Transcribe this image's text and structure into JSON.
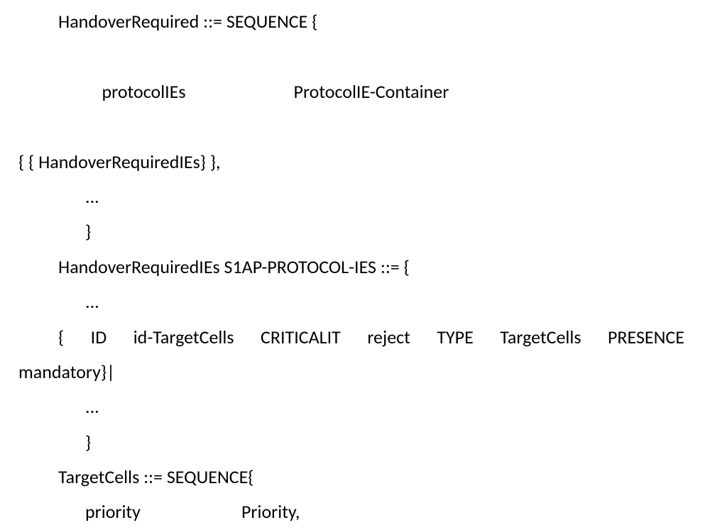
{
  "lines": {
    "l1": "HandoverRequired ::= SEQUENCE {",
    "l2a": "protocolIEs",
    "l2b": "ProtocolIE-Container",
    "l3": "{ { HandoverRequiredIEs} },",
    "l4": "...",
    "l5": "}",
    "l6": "HandoverRequiredIEs S1AP-PROTOCOL-IES ::= {",
    "l7": "...",
    "ie": {
      "open": "{",
      "w1": "ID",
      "w2": "id-TargetCells",
      "w3": "CRITICALIT",
      "w4": "reject",
      "w5": "TYPE",
      "w6": "TargetCells",
      "w7": "PRESENCE"
    },
    "l9": "mandatory}|",
    "l10": "...",
    "l11": "}",
    "l12": "TargetCells ::= SEQUENCE{",
    "l13a": "priority",
    "l13b": "Priority,"
  }
}
